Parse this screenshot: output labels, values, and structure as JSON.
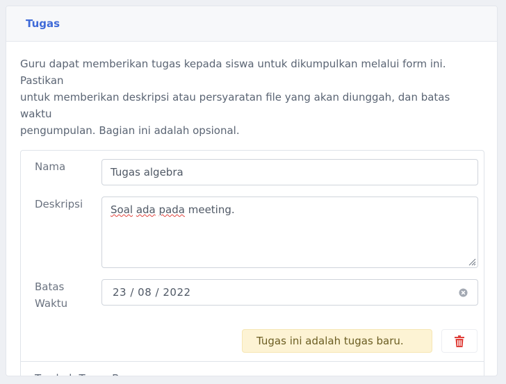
{
  "card": {
    "title": "Tugas",
    "intro": "Guru dapat memberikan tugas kepada siswa untuk dikumpulkan melalui form ini. Pastikan\nuntuk memberikan deskripsi atau persyaratan file yang akan diunggah, dan batas waktu\npengumpulan. Bagian ini adalah opsional."
  },
  "form": {
    "name_label": "Nama",
    "name_value": "Tugas algebra",
    "description_label": "Deskripsi",
    "description_value": {
      "word1": "Soal",
      "word2": "ada",
      "word3": "pada",
      "rest": " meeting."
    },
    "deadline_label_line1": "Batas",
    "deadline_label_line2": "Waktu",
    "deadline_value": "23 / 08 / 2022",
    "status_text": "Tugas ini adalah tugas baru.",
    "delete_icon": "trash-icon",
    "add_link": "Tambah Tugas Baru"
  },
  "colors": {
    "accent": "#3f6ad8",
    "danger": "#e0403a",
    "status_bg": "#fdf3d4"
  }
}
